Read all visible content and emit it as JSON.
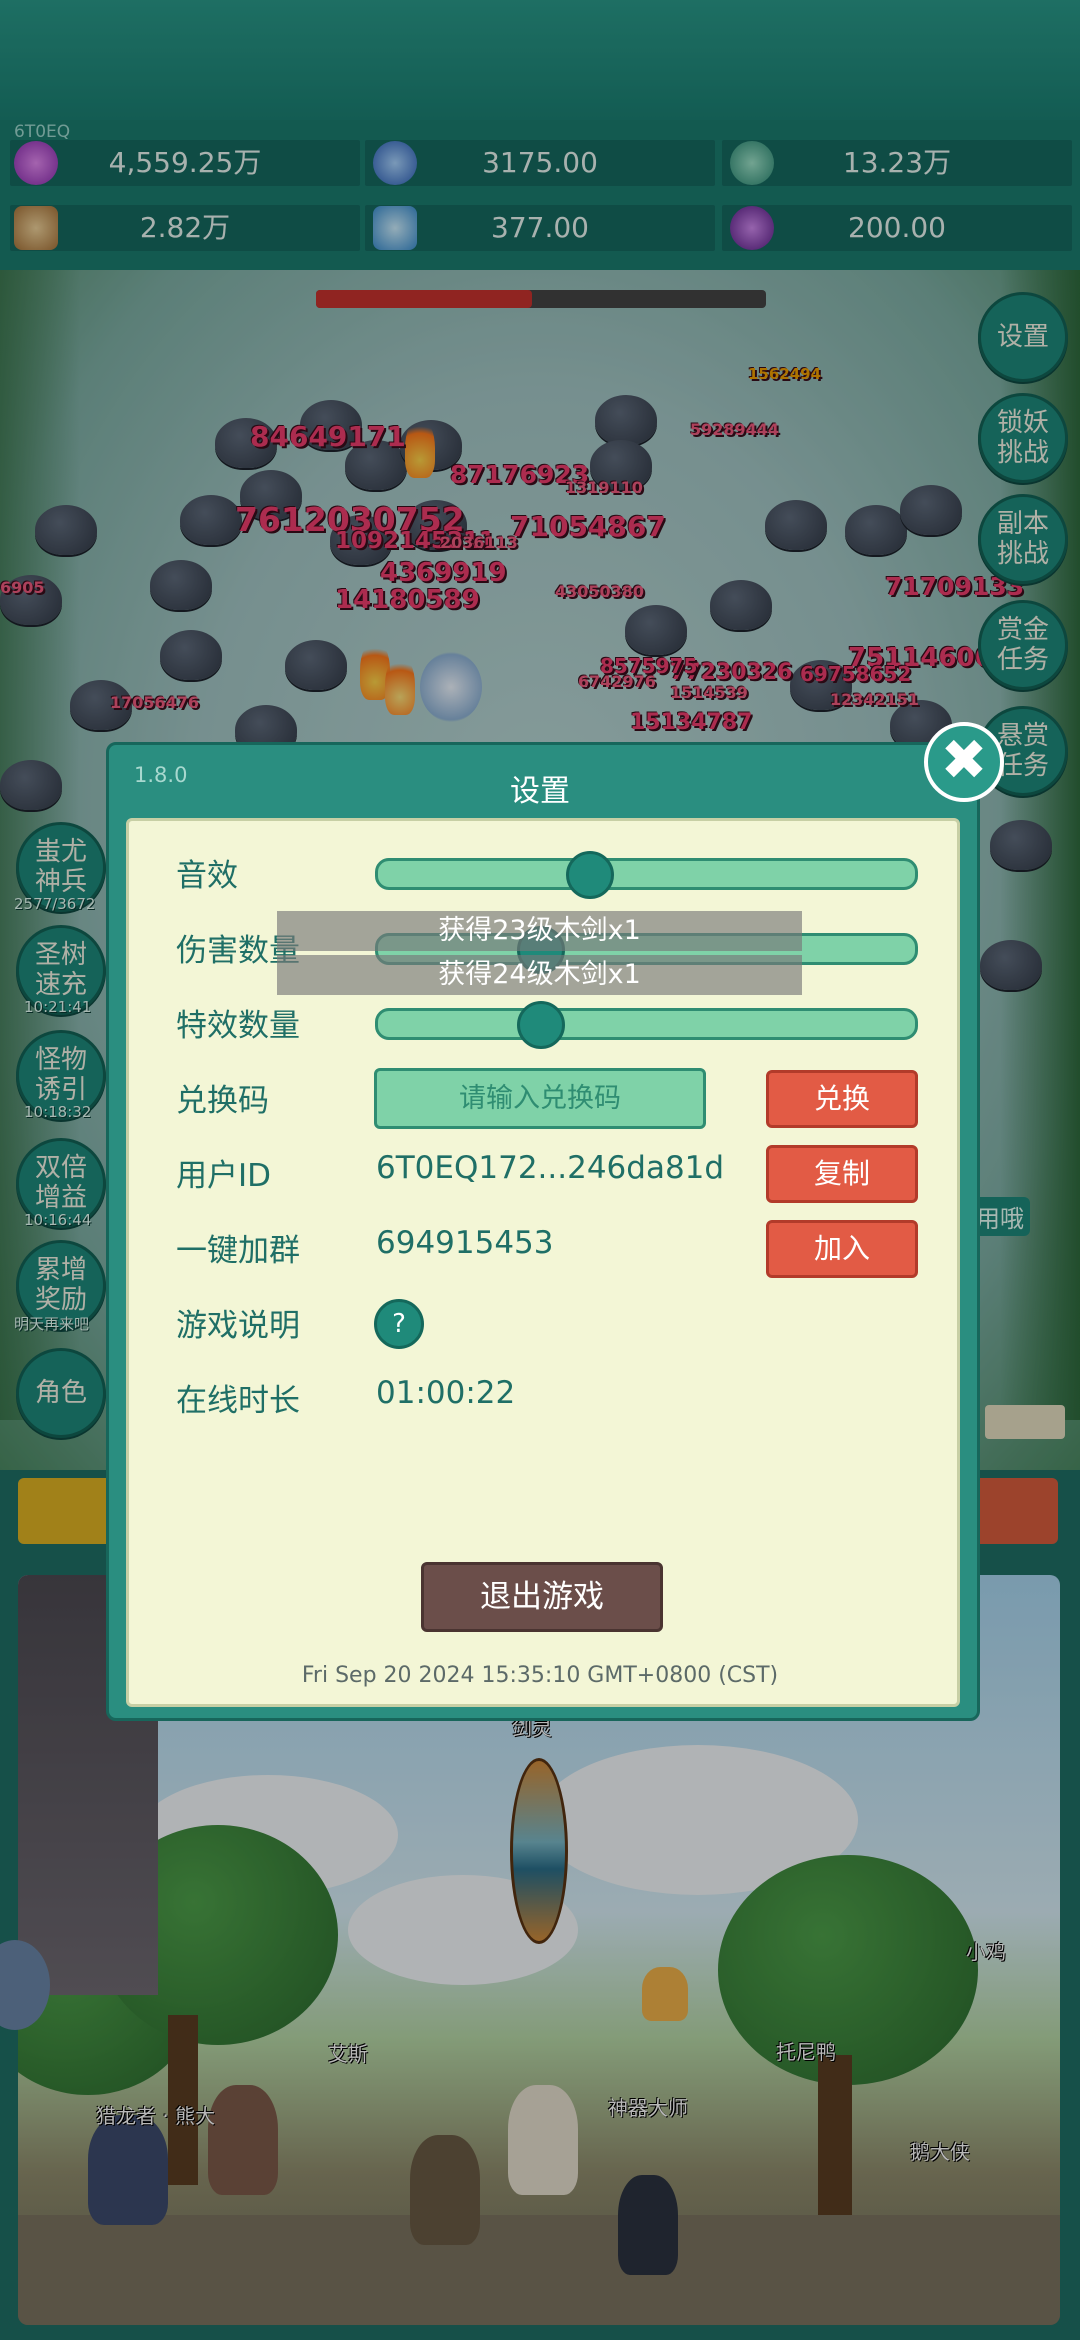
{
  "resources": [
    {
      "icon": "purple-gem-icon",
      "value": "4,559.25万",
      "color": "#b44ad8"
    },
    {
      "icon": "blue-orb-icon",
      "value": "3175.00",
      "color": "#3f7ed8"
    },
    {
      "icon": "globe-icon",
      "value": "13.23万",
      "color": "#3fb09a"
    },
    {
      "icon": "scroll-icon",
      "value": "2.82万",
      "color": "#c79a55"
    },
    {
      "icon": "ice-crystal-icon",
      "value": "377.00",
      "color": "#4fb6e6"
    },
    {
      "icon": "potion-icon",
      "value": "200.00",
      "color": "#8a3fb0"
    }
  ],
  "player_id_short": "6T0EQ",
  "boss_hp_fraction": 0.48,
  "damage_numbers": [
    "84649171",
    "87176923",
    "7612030752",
    "71054867",
    "1092145211",
    "4369919",
    "14180589",
    "71709133",
    "75114606",
    "77230326",
    "15134787",
    "59289444",
    "1319110",
    "2036113",
    "43050380",
    "1514539",
    "12342151",
    "17056476",
    "6905",
    "69758652",
    "8575975",
    "6742976",
    "1562494"
  ],
  "side_left": [
    {
      "label": "蚩尤神兵",
      "sub": "2577/3672"
    },
    {
      "label": "圣树速充",
      "sub": "10:21:41"
    },
    {
      "label": "怪物诱引",
      "sub": "10:18:32"
    },
    {
      "label": "双倍增益",
      "sub": "10:16:44"
    },
    {
      "label": "累增奖励",
      "sub": "明天再来吧"
    },
    {
      "label": "角色",
      "sub": ""
    }
  ],
  "side_right": [
    "设置",
    "锁妖挑战",
    "副本挑战",
    "赏金任务",
    "悬赏任务"
  ],
  "dialog": {
    "version": "1.8.0",
    "title": "设置",
    "rows": {
      "sound": "音效",
      "damage_count": "伤害数量",
      "effect_count": "特效数量",
      "redeem": "兑换码",
      "user_id": "用户ID",
      "join_group": "一键加群",
      "game_info": "游戏说明",
      "online_time": "在线时长"
    },
    "sliders": {
      "sound": 0.38,
      "damage_count": 0.28,
      "effect_count": 0.28
    },
    "redeem_placeholder": "请输入兑换码",
    "redeem_button": "兑换",
    "user_id_value": "6T0EQ172...246da81d",
    "copy_button": "复制",
    "group_value": "694915453",
    "join_button": "加入",
    "help_symbol": "?",
    "online_value": "01:00:22",
    "exit_button": "退出游戏",
    "timestamp": "Fri Sep 20 2024 15:35:10 GMT+0800 (CST)",
    "close_symbol": "✖"
  },
  "toasts": [
    "获得23级木剑x1",
    "获得24级木剑x1"
  ],
  "scene_labels": {
    "sword_spirit": "剑灵",
    "chick": "小鸡",
    "aisi": "艾斯",
    "tony_duck": "托尼鸭",
    "hunter": "猎龙者 · 熊大",
    "smith": "神器大师",
    "goose": "鹅大侠",
    "partial_tag": "用哦"
  }
}
